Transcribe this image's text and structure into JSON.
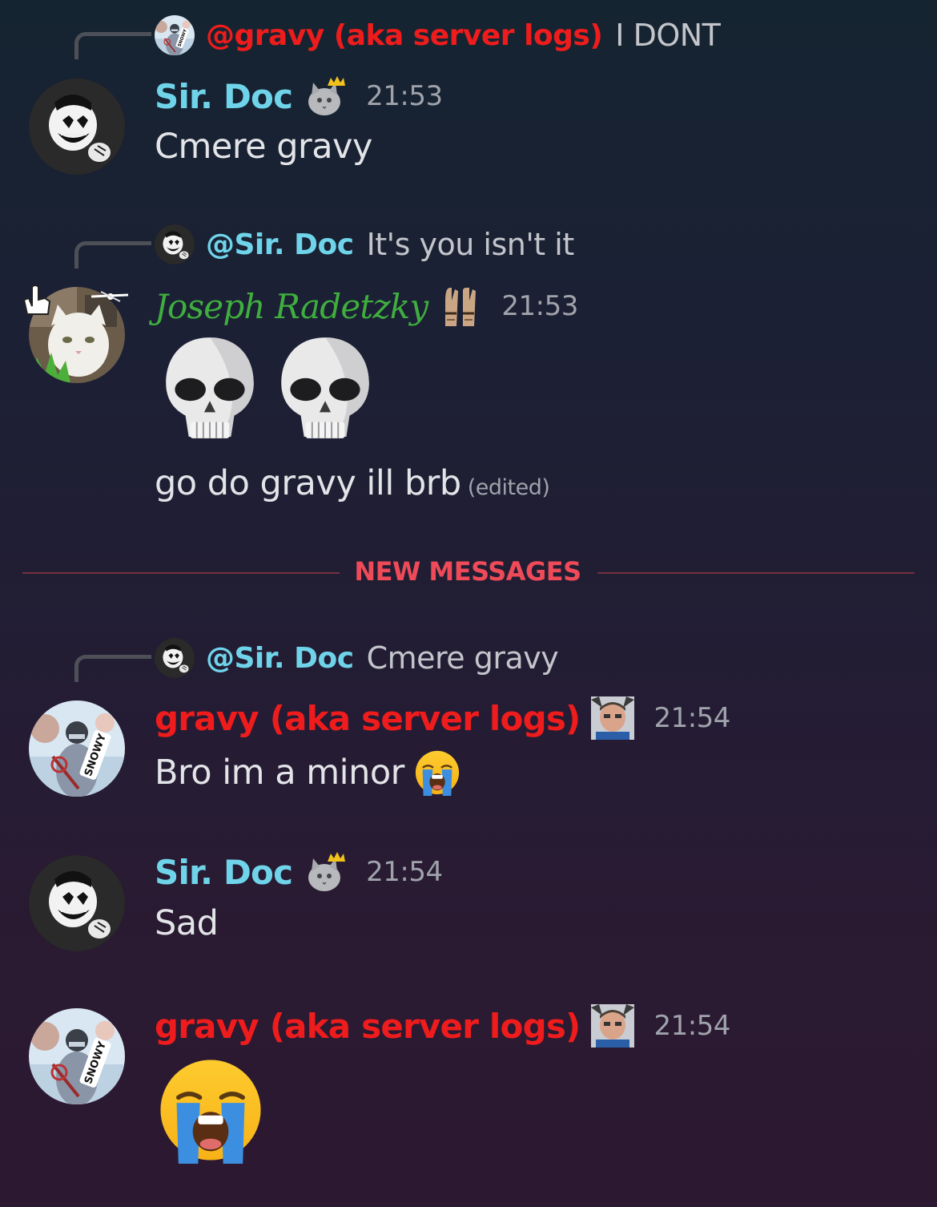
{
  "colors": {
    "gravy_name": "#ee1c1c",
    "sir_doc_name": "#6fd4ea",
    "joseph_name": "#3fae3f",
    "new_messages": "#ef4a58",
    "timestamp": "#a0a3ab"
  },
  "messages": [
    {
      "reply": {
        "avatar": "snowy-avatar",
        "name": "@gravy (aka server logs)",
        "text": "I DONT"
      },
      "author": "Sir. Doc",
      "badge": "cat-crown-icon",
      "time": "21:53",
      "text": "Cmere gravy"
    },
    {
      "reply": {
        "avatar": "bendy-avatar",
        "name": "@Sir. Doc",
        "text": "It's you isn't it"
      },
      "author": "Joseph Radetzky",
      "badge": "gloves-icon",
      "time": "21:53",
      "emojis": [
        "skull-emoji",
        "skull-emoji"
      ],
      "text": "go do gravy ill brb",
      "edited": "(edited)"
    },
    {
      "reply": {
        "avatar": "bendy-avatar",
        "name": "@Sir. Doc",
        "text": "Cmere gravy"
      },
      "author": "gravy (aka server logs)",
      "badge": "face-cat-ears-icon",
      "time": "21:54",
      "text": "Bro im a minor",
      "inline_emoji": "loudly-crying-emoji"
    },
    {
      "author": "Sir. Doc",
      "badge": "cat-crown-icon",
      "time": "21:54",
      "text": "Sad"
    },
    {
      "author": "gravy (aka server logs)",
      "badge": "face-cat-ears-icon",
      "time": "21:54",
      "emojis": [
        "loudly-crying-emoji"
      ]
    }
  ],
  "divider": {
    "label": "NEW MESSAGES"
  }
}
